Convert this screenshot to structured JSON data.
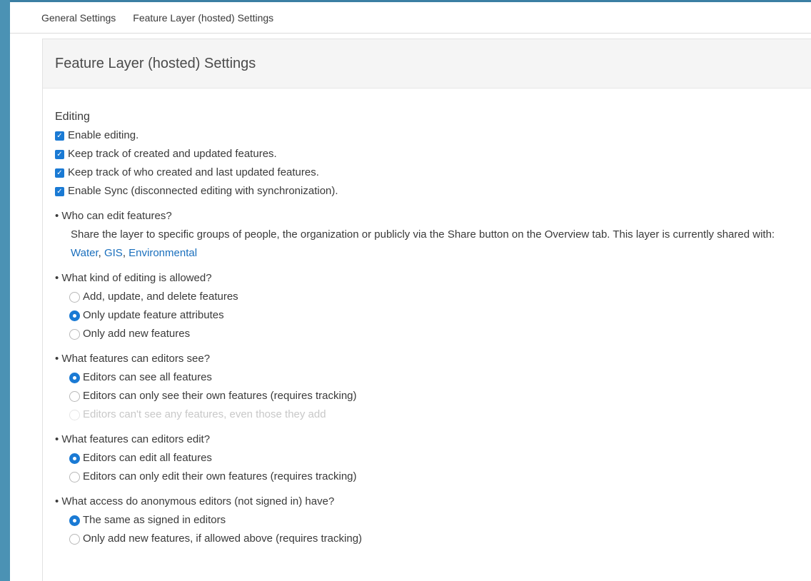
{
  "nav": {
    "general": "General Settings",
    "feature_layer": "Feature Layer (hosted) Settings"
  },
  "panel": {
    "title": "Feature Layer (hosted) Settings"
  },
  "editing": {
    "title": "Editing",
    "checkboxes": [
      {
        "label": "Enable editing.",
        "checked": true
      },
      {
        "label": "Keep track of created and updated features.",
        "checked": true
      },
      {
        "label": "Keep track of who created and last updated features.",
        "checked": true
      },
      {
        "label": "Enable Sync (disconnected editing with synchronization).",
        "checked": true
      }
    ]
  },
  "who_can_edit": {
    "question": "• Who can edit features?",
    "text": "Share the layer to specific groups of people, the organization or publicly via the Share button on the Overview tab. This layer is currently shared with: ",
    "groups": [
      "Water",
      "GIS",
      "Environmental"
    ],
    "separator": ", "
  },
  "kind_of_editing": {
    "question": "• What kind of editing is allowed?",
    "options": [
      {
        "label": "Add, update, and delete features",
        "selected": false
      },
      {
        "label": "Only update feature attributes",
        "selected": true
      },
      {
        "label": "Only add new features",
        "selected": false
      }
    ]
  },
  "features_see": {
    "question": "• What features can editors see?",
    "options": [
      {
        "label": "Editors can see all features",
        "selected": true
      },
      {
        "label": "Editors can only see their own features (requires tracking)",
        "selected": false
      },
      {
        "label": "Editors can't see any features, even those they add",
        "selected": false,
        "disabled": true
      }
    ]
  },
  "features_edit": {
    "question": "• What features can editors edit?",
    "options": [
      {
        "label": "Editors can edit all features",
        "selected": true
      },
      {
        "label": "Editors can only edit their own features (requires tracking)",
        "selected": false
      }
    ]
  },
  "anonymous": {
    "question": "• What access do anonymous editors (not signed in) have?",
    "options": [
      {
        "label": "The same as signed in editors",
        "selected": true
      },
      {
        "label": "Only add new features, if allowed above (requires tracking)",
        "selected": false
      }
    ]
  },
  "colors": {
    "accent": "#1a7ad4",
    "link": "#1a6fbd",
    "background": "#4b92b4"
  },
  "icons": {
    "checkbox_checked": "check-icon"
  }
}
